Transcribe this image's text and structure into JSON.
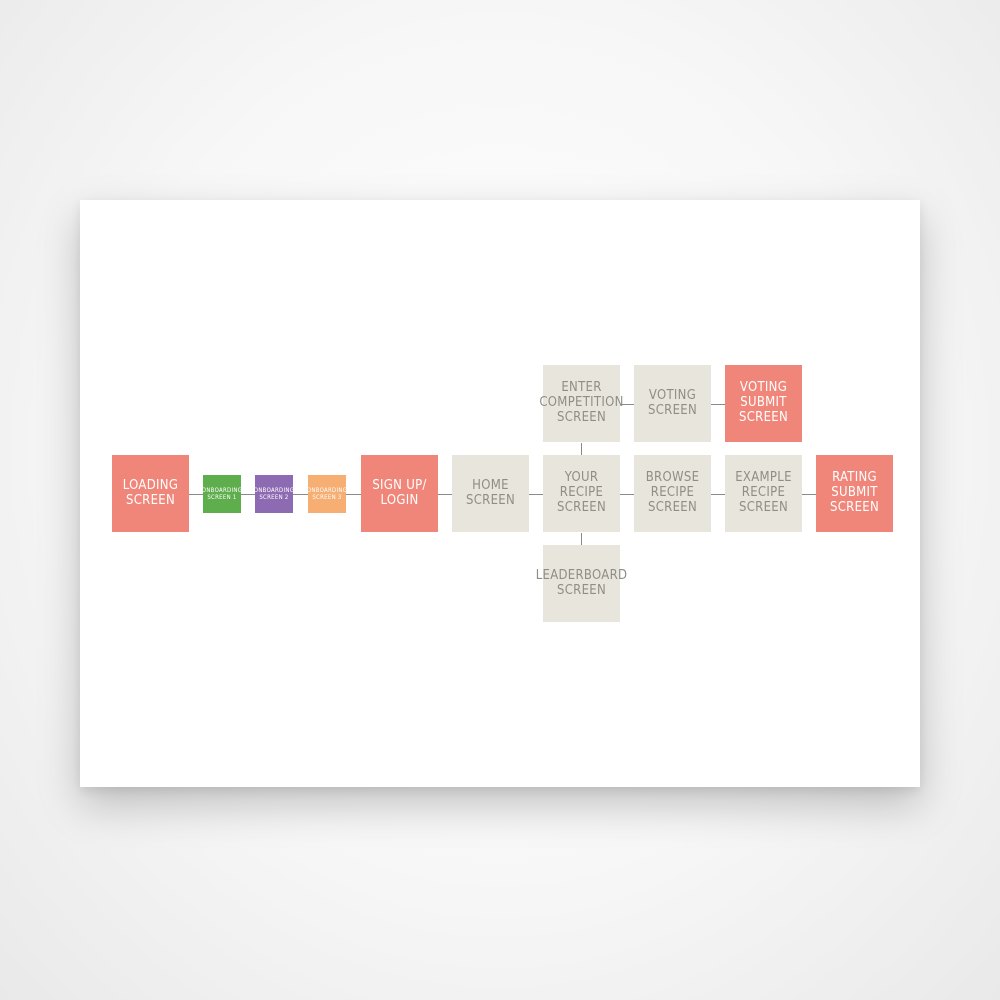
{
  "flowchart": {
    "colors": {
      "salmon": "#f0867a",
      "green": "#5fae4e",
      "purple": "#8d6bb3",
      "orange": "#f6ae72",
      "beige": "#e8e6dc",
      "connector": "#8a8a8a"
    },
    "nodes": {
      "loading": "LOADING\nSCREEN",
      "onboarding1": "ONBOARDING\nSCREEN 1",
      "onboarding2": "ONBOARDING\nSCREEN 2",
      "onboarding3": "ONBOARDING\nSCREEN 3",
      "signup": "SIGN UP/\nLOGIN",
      "home": "HOME\nSCREEN",
      "enter_competition": "ENTER\nCOMPETITION\nSCREEN",
      "voting": "VOTING\nSCREEN",
      "voting_submit": "VOTING\nSUBMIT\nSCREEN",
      "your_recipe": "YOUR\nRECIPE\nSCREEN",
      "browse_recipe": "BROWSE\nRECIPE\nSCREEN",
      "example_recipe": "EXAMPLE\nRECIPE\nSCREEN",
      "rating_submit": "RATING\nSUBMIT\nSCREEN",
      "leaderboard": "LEADERBOARD\nSCREEN"
    }
  }
}
